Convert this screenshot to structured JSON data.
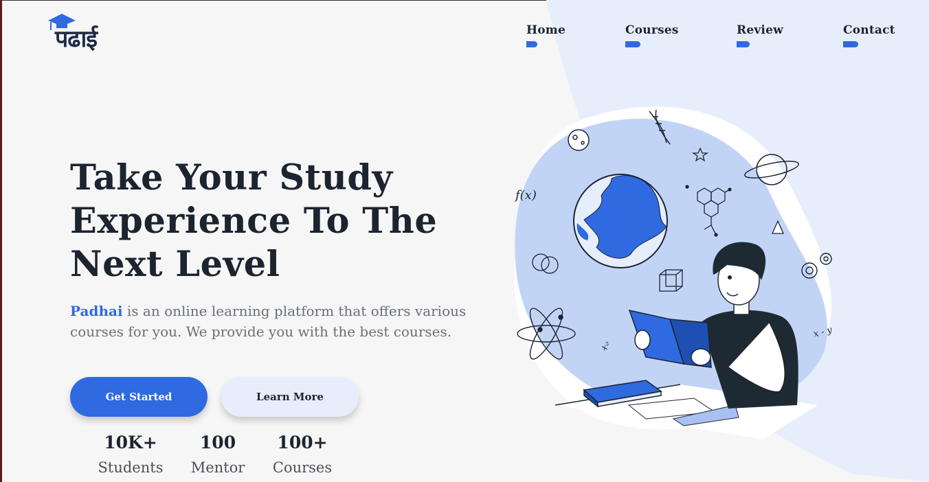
{
  "brand": {
    "logo_text": "पढाई",
    "name": "Padhai",
    "accent_color": "#2f6ae0"
  },
  "nav": {
    "items": [
      {
        "label": "Home"
      },
      {
        "label": "Courses"
      },
      {
        "label": "Review"
      },
      {
        "label": "Contact"
      }
    ]
  },
  "hero": {
    "title_line1": "Take Your Study",
    "title_line2": "Experience To The",
    "title_line3": "Next Level",
    "description_brand": "Padhai",
    "description_rest": " is an online learning platform that offers various courses for you. We provide you with the best courses.",
    "primary_button": "Get Started",
    "secondary_button": "Learn More"
  },
  "stats": [
    {
      "value": "10K+",
      "label": "Students"
    },
    {
      "value": "100",
      "label": "Mentor"
    },
    {
      "value": "100+",
      "label": "Courses"
    }
  ],
  "illustration": {
    "labels": {
      "function": "f(x)",
      "squared": "x²",
      "minus": "x - y"
    },
    "icons": [
      "globe-icon",
      "planet-icon",
      "dna-icon",
      "star-icon",
      "moon-icon",
      "molecule-icon",
      "pyramid-icon",
      "gear-icon",
      "cube-icon",
      "venn-icon",
      "atom-icon",
      "book-icon"
    ]
  }
}
